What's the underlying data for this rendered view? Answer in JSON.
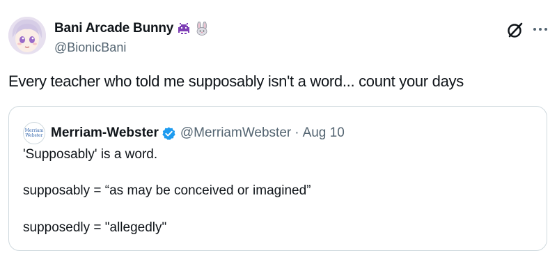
{
  "author": {
    "display_name": "Bani Arcade Bunny",
    "handle": "@BionicBani",
    "avatar_icon": "anime-avatar",
    "name_emojis": [
      "space-invader-icon",
      "rabbit-icon"
    ]
  },
  "tweet": {
    "text": "Every teacher who told me supposably isn't a word... count your days"
  },
  "quoted_tweet": {
    "avatar_text": [
      "Merriam",
      "Webster"
    ],
    "display_name": "Merriam-Webster",
    "verified": true,
    "handle": "@MerriamWebster",
    "separator": "·",
    "date": "Aug 10",
    "lines": [
      "'Supposably' is a word.",
      "supposably = “as may be conceived or imagined”",
      "supposedly = \"allegedly\""
    ]
  },
  "colors": {
    "text": "#0f1419",
    "secondary": "#536471",
    "border": "#cfd9de",
    "verified": "#1d9bf0",
    "emoji_purple": "#7e3fb5"
  },
  "icons": {
    "grok": "grok-icon",
    "more": "more-dots-icon",
    "verified": "verified-badge-icon"
  }
}
